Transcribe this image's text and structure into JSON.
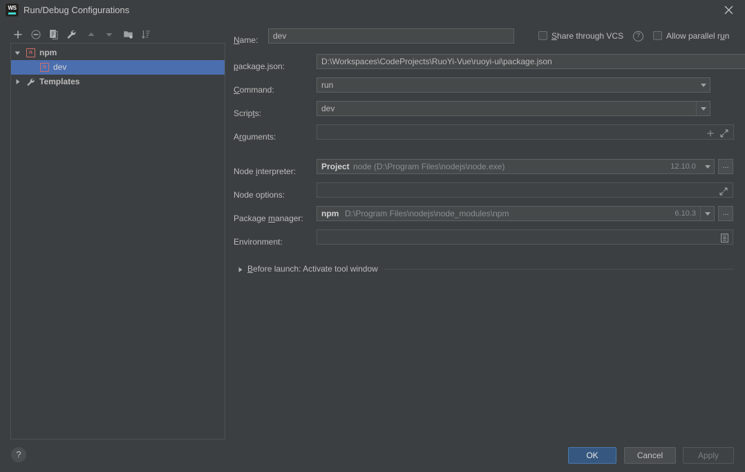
{
  "window": {
    "title": "Run/Debug Configurations",
    "app_icon": "webstorm-logo-icon",
    "logo_text": "WS",
    "close_icon": "close-icon"
  },
  "toolbar": {
    "buttons": [
      {
        "name": "add-configuration-button",
        "icon": "plus-icon",
        "title": "Add New Configuration"
      },
      {
        "name": "remove-configuration-button",
        "icon": "minus-icon",
        "title": "Remove Configuration"
      },
      {
        "name": "copy-configuration-button",
        "icon": "copy-icon",
        "title": "Copy Configuration"
      },
      {
        "name": "edit-defaults-button",
        "icon": "wrench-icon",
        "title": "Edit defaults"
      },
      {
        "name": "move-up-button",
        "icon": "arrow-up-icon",
        "title": "Move Up"
      },
      {
        "name": "move-down-button",
        "icon": "arrow-down-icon",
        "title": "Move Down"
      },
      {
        "name": "create-folder-button",
        "icon": "folder-add-icon",
        "title": "Create New Folder"
      },
      {
        "name": "sort-button",
        "icon": "sort-alphabetically-icon",
        "title": "Sort Configurations"
      }
    ]
  },
  "tree": {
    "nodes": [
      {
        "label": "npm",
        "icon": "npm-icon",
        "icon_glyph": "n",
        "expanded": true,
        "arrow": "chevron-down-icon",
        "selected": false,
        "bold": true,
        "indent": 0
      },
      {
        "label": "dev",
        "icon": "npm-icon",
        "icon_glyph": "n",
        "expanded": false,
        "arrow": "",
        "selected": true,
        "bold": false,
        "indent": 1
      },
      {
        "label": "Templates",
        "icon": "wrench-icon",
        "icon_glyph": "",
        "expanded": false,
        "arrow": "chevron-right-icon",
        "selected": false,
        "bold": true,
        "indent": 0
      }
    ]
  },
  "form": {
    "name": {
      "label": "Name:",
      "label_mnemonic": "N",
      "value": "dev",
      "placeholder": ""
    },
    "share_through_vcs": {
      "label": "Share through VCS",
      "label_mnemonic": "S",
      "checked": false,
      "help_icon": "question-mark-icon"
    },
    "allow_parallel_run": {
      "label": "Allow parallel run",
      "label_mnemonic": "u",
      "checked": false
    },
    "package_json": {
      "label": "package.json:",
      "label_mnemonic": "p",
      "value": "D:\\Workspaces\\CodeProjects\\RuoYi-Vue\\ruoyi-ui\\package.json",
      "dropdown_icon": "chevron-down-icon",
      "browse_label": "..."
    },
    "command": {
      "label": "Command:",
      "label_mnemonic": "C",
      "value": "run",
      "dropdown_icon": "chevron-down-icon"
    },
    "scripts": {
      "label": "Scripts:",
      "label_mnemonic": "t",
      "value": "dev",
      "dropdown_icon": "chevron-down-icon"
    },
    "arguments": {
      "label": "Arguments:",
      "label_mnemonic": "r",
      "value": "",
      "add_icon": "plus-icon",
      "expand_icon": "expand-icon"
    },
    "node_interpreter": {
      "label": "Node interpreter:",
      "label_mnemonic": "i",
      "scope": "Project",
      "value": "node (D:\\Program Files\\nodejs\\node.exe)",
      "version": "12.10.0",
      "dropdown_icon": "chevron-down-icon",
      "browse_label": "..."
    },
    "node_options": {
      "label": "Node options:",
      "value": "",
      "expand_icon": "expand-icon"
    },
    "package_manager": {
      "label": "Package manager:",
      "label_mnemonic": "m",
      "scope": "npm",
      "value": "D:\\Program Files\\nodejs\\node_modules\\npm",
      "version": "6.10.3",
      "dropdown_icon": "chevron-down-icon",
      "browse_label": "..."
    },
    "environment": {
      "label": "Environment:",
      "value": "",
      "editor_icon": "list-editor-icon"
    },
    "before_launch": {
      "label": "Before launch: Activate tool window",
      "label_mnemonic": "B",
      "expanded": false,
      "arrow": "chevron-right-icon"
    }
  },
  "footer": {
    "help_label": "?",
    "ok_label": "OK",
    "cancel_label": "Cancel",
    "apply_label": "Apply"
  },
  "colors": {
    "background": "#3c3f41",
    "selection": "#4b6eaf",
    "primary_button": "#365880",
    "npm_icon": "#d0706a",
    "accent_teal": "#3ddbd0"
  }
}
